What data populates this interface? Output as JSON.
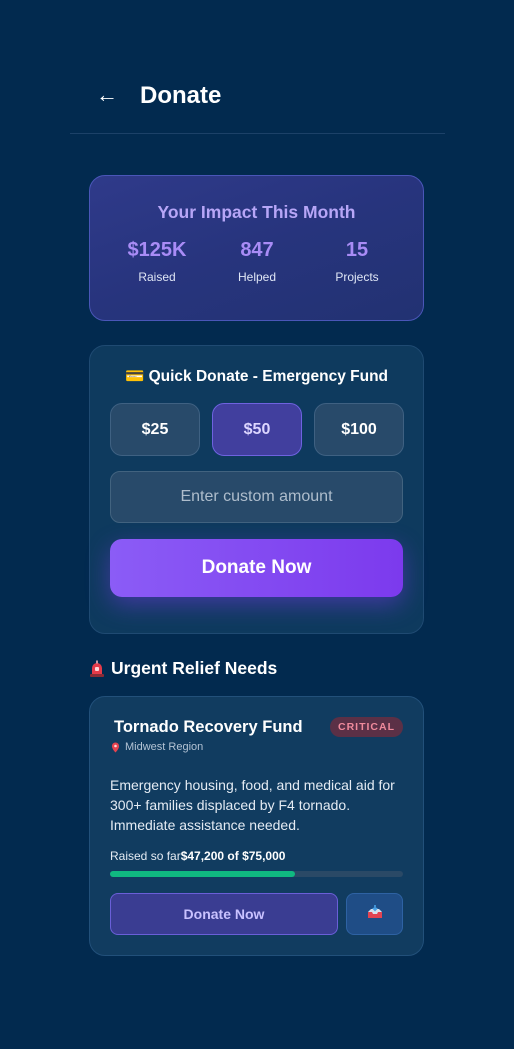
{
  "header": {
    "back_glyph": "←",
    "title": "Donate"
  },
  "impact": {
    "title": "Your Impact This Month",
    "stats": [
      {
        "value": "$125K",
        "label": "Raised"
      },
      {
        "value": "847",
        "label": "Helped"
      },
      {
        "value": "15",
        "label": "Projects"
      }
    ]
  },
  "quick_donate": {
    "icon": "credit-card-icon",
    "title": "💳 Quick Donate - Emergency Fund",
    "amounts": [
      "$25",
      "$50",
      "$100"
    ],
    "selected_amount": "$50",
    "custom_placeholder": "Enter custom amount",
    "custom_value": "",
    "donate_label": "Donate Now"
  },
  "urgent": {
    "icon": "siren-icon",
    "heading": "Urgent Relief Needs",
    "card": {
      "title": "Tornado Recovery Fund",
      "badge": "CRITICAL",
      "region_icon": "pin-icon",
      "region": "Midwest Region",
      "description": "Emergency housing, food, and medical aid for 300+ families displaced by F4 tornado. Immediate assistance needed.",
      "raised_label": "Raised so far",
      "raised_amount": "$47,200 of $75,000",
      "progress_fraction": 0.63,
      "donate_label": "Donate Now",
      "share_icon": "inbox-tray-icon"
    }
  },
  "colors": {
    "background": "#022a4f",
    "accent_purple": "#8b5cf6",
    "progress_green": "#10b981",
    "critical_text": "#f08a9c"
  }
}
